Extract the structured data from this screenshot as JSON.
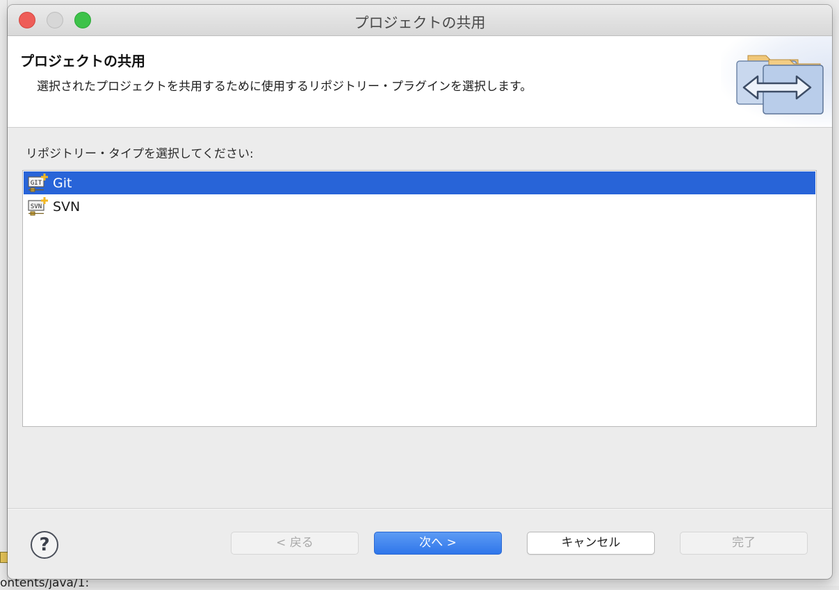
{
  "window": {
    "title": "プロジェクトの共用"
  },
  "banner": {
    "title": "プロジェクトの共用",
    "description": "選択されたプロジェクトを共用するために使用するリポジトリー・プラグインを選択します。",
    "icon": "share-project-icon"
  },
  "content": {
    "prompt": "リポジトリー・タイプを選択してください:",
    "repository_types": [
      {
        "label": "Git",
        "icon": "git-repository-icon",
        "badge": "GIT",
        "selected": true
      },
      {
        "label": "SVN",
        "icon": "svn-repository-icon",
        "badge": "SVN",
        "selected": false
      }
    ]
  },
  "footer": {
    "help_label": "?",
    "back_label": "< 戻る",
    "next_label": "次へ >",
    "cancel_label": "キャンセル",
    "finish_label": "完了"
  },
  "background": {
    "partial_text": "ontents/java/1:"
  },
  "colors": {
    "selection": "#2864d8",
    "primary_button": "#2f76ea",
    "close": "#ee5d58",
    "maximize": "#3ec24a"
  }
}
